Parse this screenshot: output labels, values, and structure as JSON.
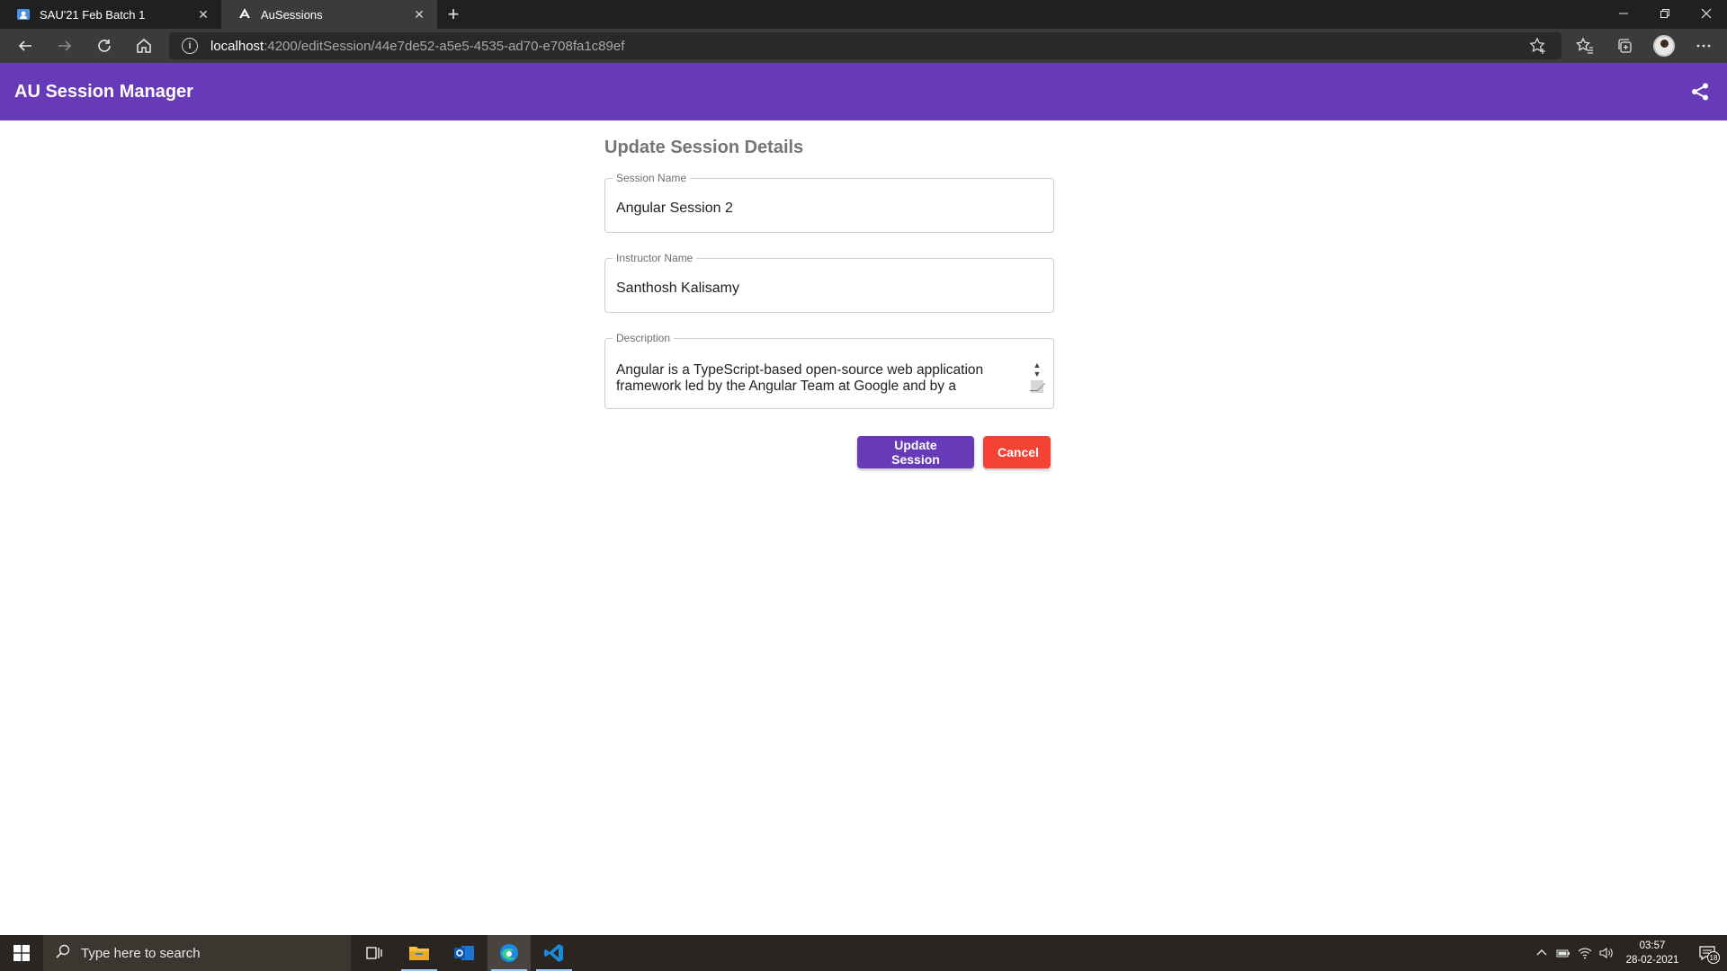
{
  "browser": {
    "tabs": [
      {
        "title": "SAU'21 Feb Batch 1",
        "icon": "teams-icon",
        "active": false
      },
      {
        "title": "AuSessions",
        "icon": "angular-icon",
        "active": true
      }
    ],
    "url_host": "localhost",
    "url_rest": ":4200/editSession/44e7de52-a5e5-4535-ad70-e708fa1c89ef"
  },
  "app": {
    "title": "AU Session Manager",
    "accent": "#673ab7"
  },
  "form": {
    "title": "Update Session Details",
    "session_name_label": "Session Name",
    "session_name_value": "Angular Session 2",
    "instructor_label": "Instructor Name",
    "instructor_value": "Santhosh Kalisamy",
    "description_label": "Description",
    "description_value": "Angular is a TypeScript-based open-source web application framework led by the Angular Team at Google and by a",
    "update_button": "Update Session",
    "cancel_button": "Cancel",
    "cancel_color": "#f44336"
  },
  "taskbar": {
    "search_placeholder": "Type here to search",
    "time": "03:57",
    "date": "28-02-2021",
    "notification_count": "18"
  }
}
